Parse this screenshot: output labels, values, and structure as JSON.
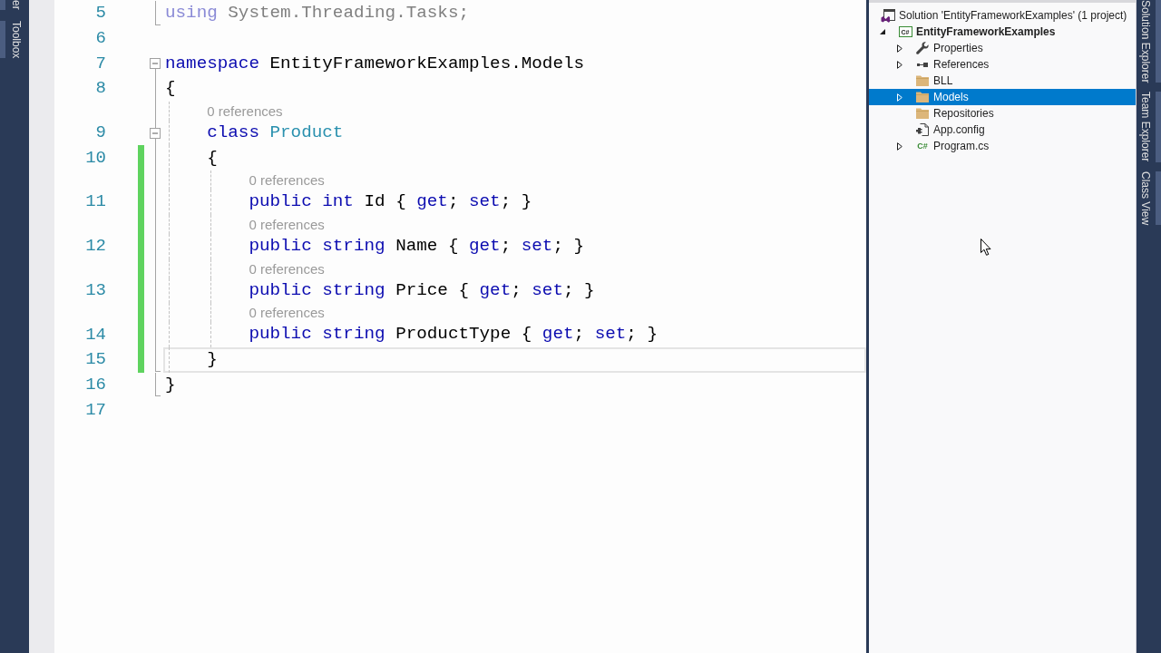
{
  "left_tool_strip": {
    "tabs": [
      {
        "label": "er"
      },
      {
        "label": "Toolbox"
      }
    ]
  },
  "editor": {
    "lines": [
      {
        "number": "5",
        "outline": {
          "kind": "end"
        },
        "changed": false,
        "current": false,
        "tokens": [
          {
            "text": "using",
            "kind": "unused_keyword"
          },
          {
            "text": " System.Threading.Tasks;",
            "kind": "unused"
          }
        ]
      },
      {
        "number": "6",
        "changed": false,
        "current": false
      },
      {
        "number": "7",
        "outline": {
          "kind": "fold",
          "expanded": true
        },
        "changed": false,
        "current": false,
        "tokens": [
          {
            "text": "namespace",
            "kind": "keyword"
          },
          {
            "text": " EntityFrameworkExamples.Models",
            "kind": "plain"
          }
        ]
      },
      {
        "number": "8",
        "outline": {
          "kind": "inside"
        },
        "changed": false,
        "current": false,
        "tokens": [
          {
            "text": "{",
            "kind": "plain"
          }
        ],
        "children": [
          {
            "number": "9",
            "code_lens": "0 references",
            "outline": {
              "kind": "fold",
              "expanded": true
            },
            "changed": false,
            "current": false,
            "tokens": [
              {
                "text": "class",
                "kind": "keyword"
              },
              {
                "text": " Product",
                "kind": "type"
              }
            ]
          },
          {
            "number": "10",
            "outline": {
              "kind": "inside"
            },
            "changed": true,
            "current": false,
            "tokens": [
              {
                "text": "{",
                "kind": "plain"
              }
            ],
            "children": [
              {
                "number": "11",
                "code_lens": "0 references",
                "outline": {
                  "kind": "inside"
                },
                "changed": true,
                "current": false,
                "tokens": [
                  {
                    "text": "public",
                    "kind": "keyword"
                  },
                  {
                    "text": " int",
                    "kind": "keyword"
                  },
                  {
                    "text": " Id { ",
                    "kind": "plain"
                  },
                  {
                    "text": "get",
                    "kind": "keyword"
                  },
                  {
                    "text": "; ",
                    "kind": "plain"
                  },
                  {
                    "text": "set",
                    "kind": "keyword"
                  },
                  {
                    "text": "; }",
                    "kind": "plain"
                  }
                ]
              },
              {
                "number": "12",
                "code_lens": "0 references",
                "outline": {
                  "kind": "inside"
                },
                "changed": true,
                "current": false,
                "tokens": [
                  {
                    "text": "public",
                    "kind": "keyword"
                  },
                  {
                    "text": " string",
                    "kind": "keyword"
                  },
                  {
                    "text": " Name { ",
                    "kind": "plain"
                  },
                  {
                    "text": "get",
                    "kind": "keyword"
                  },
                  {
                    "text": "; ",
                    "kind": "plain"
                  },
                  {
                    "text": "set",
                    "kind": "keyword"
                  },
                  {
                    "text": "; }",
                    "kind": "plain"
                  }
                ]
              },
              {
                "number": "13",
                "code_lens": "0 references",
                "outline": {
                  "kind": "inside"
                },
                "changed": true,
                "current": false,
                "tokens": [
                  {
                    "text": "public",
                    "kind": "keyword"
                  },
                  {
                    "text": " string",
                    "kind": "keyword"
                  },
                  {
                    "text": " Price { ",
                    "kind": "plain"
                  },
                  {
                    "text": "get",
                    "kind": "keyword"
                  },
                  {
                    "text": "; ",
                    "kind": "plain"
                  },
                  {
                    "text": "set",
                    "kind": "keyword"
                  },
                  {
                    "text": "; }",
                    "kind": "plain"
                  }
                ]
              },
              {
                "number": "14",
                "code_lens": "0 references",
                "outline": {
                  "kind": "inside"
                },
                "changed": true,
                "current": false,
                "tokens": [
                  {
                    "text": "public",
                    "kind": "keyword"
                  },
                  {
                    "text": " string",
                    "kind": "keyword"
                  },
                  {
                    "text": " ProductType { ",
                    "kind": "plain"
                  },
                  {
                    "text": "get",
                    "kind": "keyword"
                  },
                  {
                    "text": "; ",
                    "kind": "plain"
                  },
                  {
                    "text": "set",
                    "kind": "keyword"
                  },
                  {
                    "text": "; }",
                    "kind": "plain"
                  }
                ]
              }
            ]
          },
          {
            "number": "15",
            "outline": {
              "kind": "end"
            },
            "changed": true,
            "current": true,
            "tokens": [
              {
                "text": "}",
                "kind": "plain"
              }
            ]
          }
        ]
      },
      {
        "number": "16",
        "outline": {
          "kind": "end"
        },
        "changed": false,
        "current": false,
        "tokens": [
          {
            "text": "}",
            "kind": "plain"
          }
        ]
      },
      {
        "number": "17",
        "changed": false,
        "current": false
      }
    ]
  },
  "solution_explorer": {
    "tree": [
      {
        "label": "Solution 'EntityFrameworkExamples' (1 project)",
        "kind": "solution",
        "selected": false,
        "children": [
          {
            "label": "EntityFrameworkExamples",
            "kind": "csharp_project",
            "icon_text": "C#",
            "startup": true,
            "expanded": true,
            "selected": false,
            "children": [
              {
                "label": "Properties",
                "kind": "properties",
                "expanded": false,
                "selected": false
              },
              {
                "label": "References",
                "kind": "references",
                "expanded": false,
                "selected": false
              },
              {
                "label": "BLL",
                "kind": "folder",
                "selected": false
              },
              {
                "label": "Models",
                "kind": "folder",
                "expanded": false,
                "selected": true
              },
              {
                "label": "Repositories",
                "kind": "folder",
                "selected": false
              },
              {
                "label": "App.config",
                "kind": "config",
                "selected": false
              },
              {
                "label": "Program.cs",
                "kind": "csharp_file",
                "icon_text": "C#",
                "expanded": false,
                "selected": false
              }
            ]
          }
        ]
      }
    ]
  },
  "right_tool_strip": {
    "tabs": [
      {
        "label": "Solution Explorer"
      },
      {
        "label": "Team Explorer"
      },
      {
        "label": "Class View"
      }
    ]
  }
}
